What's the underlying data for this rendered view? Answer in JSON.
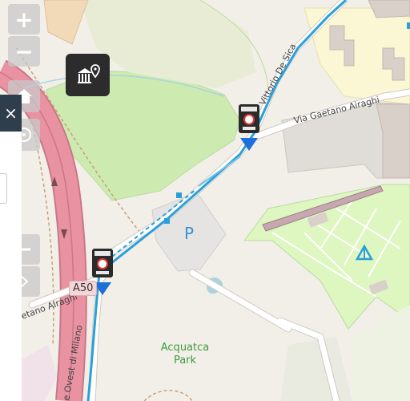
{
  "map": {
    "road_labels": {
      "via_vittorio_de_sica": "Vittorio De Sica",
      "via_gaetano_airaghi_top": "Via Gaetano Airaghi",
      "via_gaetano_airaghi_left": "etano Airaghi",
      "tangenziale": "e Ovest di Milano",
      "a50_shield": "A50"
    },
    "poi_labels": {
      "park_line1": "Acquatca",
      "park_line2": "Park",
      "parking": "P",
      "campsite": "⛺"
    },
    "colors": {
      "background": "#f2efe9",
      "park_green": "#cdebb0",
      "campsite_green": "#def6c0",
      "highway_pink": "#e892a2",
      "route_blue": "#2a9fd8",
      "residential_yellow": "#fbf7d4",
      "building_gray": "#d9d0c9"
    }
  },
  "controls": {
    "zoom_in": "+",
    "zoom_out": "−",
    "close": "×",
    "layer_icon": "museum-pin-icon",
    "home_icon": "home-icon",
    "locate_icon": "locate-icon"
  }
}
